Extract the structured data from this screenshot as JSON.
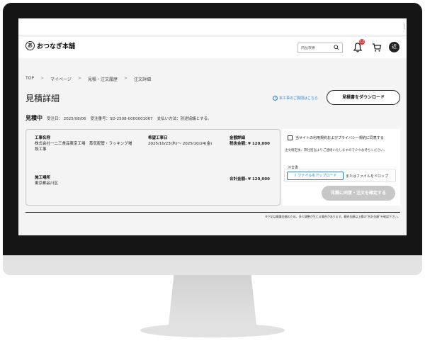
{
  "header": {
    "logo_mark": "あ",
    "logo_text": "おつなぎ本舗",
    "search_placeholder": "商品検索",
    "notification_count": "12",
    "avatar_initial": "近"
  },
  "top_strip_glyph": "|",
  "breadcrumb": [
    "TOP",
    "マイページ",
    "見積・注文履歴",
    "注文詳細"
  ],
  "breadcrumb_sep": ">",
  "page": {
    "title": "見積詳細",
    "help_link": "本工事のご質問はこちら",
    "download_button": "見積書をダウンロード"
  },
  "status": {
    "label": "見積中",
    "order_date": "受注日： 2025/08/06",
    "order_number": "受注番号：SD-2508-0000001067",
    "payment": "支払い方法：別途協議とする。"
  },
  "detail": {
    "work_name_label": "工事名称",
    "work_name_value": "株式会社一二三食品東京工場　蒸気配管・ラッキング増設工事",
    "period_label": "希望工事日",
    "period_value": "2025/10/23(木)～ 2025/10/24(金)",
    "amount_label": "金額詳細",
    "tax_amount": "税抜金額: ¥ 120,000",
    "site_label": "施工場所",
    "site_value": "東京都品川区",
    "total_amount": "合計金額: ¥ 120,000"
  },
  "agreement": {
    "checkbox_label": "当サイトの利用規約およびプライバシー規約に同意する",
    "note": "注文確定後、弊社担当よりご連絡いたしますので少々お待ちください。",
    "po_label": "注文書",
    "upload_button": "ファイルをアップロード",
    "drop_text": "またはファイルをドロップ",
    "confirm_button": "見積に同意・注文を確定する"
  },
  "footnote": "※下記は概算金額のため、多少調整が生じる場合があります。最終金額は上欄の\"合計金額\"を確認下さい。",
  "colors": {
    "accent": "#2c7fc3",
    "badge": "#e53935",
    "disabled_button": "#c7c7c7"
  }
}
